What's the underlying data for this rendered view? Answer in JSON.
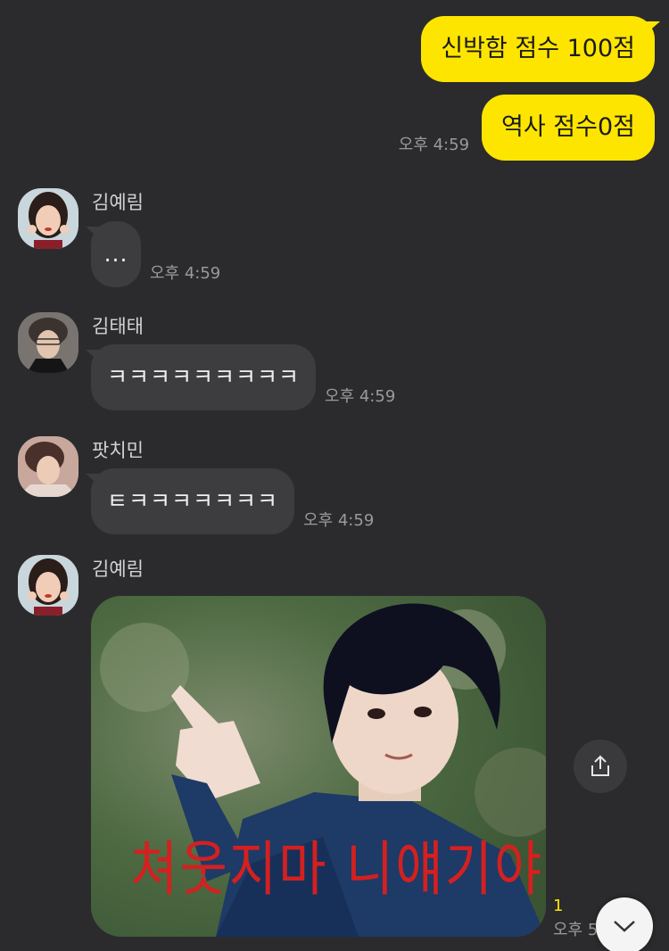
{
  "messages": {
    "me1": {
      "text": "신박함 점수 100점"
    },
    "me2": {
      "text": "역사 점수0점",
      "time": "오후 4:59"
    },
    "m1": {
      "sender": "김예림",
      "text": "...",
      "time": "오후 4:59"
    },
    "m2": {
      "sender": "김태태",
      "text": "ㅋㅋㅋㅋㅋㅋㅋㅋㅋ",
      "time": "오후 4:59"
    },
    "m3": {
      "sender": "팟치민",
      "text": "ㅌㅋㅋㅋㅋㅋㅋㅋ",
      "time": "오후 4:59"
    },
    "m4": {
      "sender": "김예림",
      "image_caption": "쳐웃지마 니얘기야",
      "unread": "1",
      "time": "오후 5"
    }
  },
  "icons": {
    "share": "share-icon",
    "scroll": "chevron-down-icon"
  },
  "colors": {
    "background": "#2b2b2d",
    "my_bubble": "#fee500",
    "other_bubble": "#3d3d40",
    "caption_red": "#d42020"
  }
}
